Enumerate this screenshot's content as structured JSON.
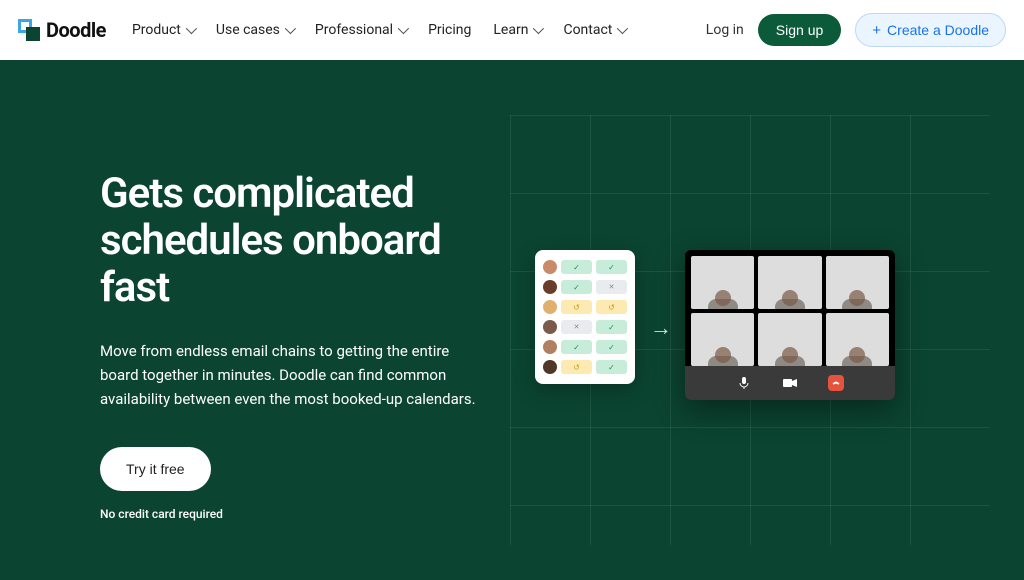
{
  "brand": {
    "name": "Doodle"
  },
  "nav": {
    "items": [
      {
        "label": "Product",
        "has_menu": true
      },
      {
        "label": "Use cases",
        "has_menu": true
      },
      {
        "label": "Professional",
        "has_menu": true
      },
      {
        "label": "Pricing",
        "has_menu": false
      },
      {
        "label": "Learn",
        "has_menu": true
      },
      {
        "label": "Contact",
        "has_menu": true
      }
    ]
  },
  "header_actions": {
    "login": "Log in",
    "signup": "Sign up",
    "create": "Create a Doodle"
  },
  "hero": {
    "title": "Gets complicated schedules onboard fast",
    "subtitle": "Move from endless email chains to getting the entire board together in minutes. Doodle can find common availability between even the most booked-up calendars.",
    "cta": "Try it free",
    "note": "No credit card required"
  },
  "illustration": {
    "poll_rows": [
      {
        "avatar": "#c98a6a",
        "cells": [
          "g-chk",
          "g-chk"
        ]
      },
      {
        "avatar": "#6a3c2a",
        "cells": [
          "g-chk",
          "n-x"
        ]
      },
      {
        "avatar": "#e0b070",
        "cells": [
          "y-sl",
          "y-sl"
        ]
      },
      {
        "avatar": "#7a5a4a",
        "cells": [
          "n-x",
          "g-chk"
        ]
      },
      {
        "avatar": "#b08060",
        "cells": [
          "g-chk",
          "g-chk"
        ]
      },
      {
        "avatar": "#503828",
        "cells": [
          "y-sl",
          "g-chk"
        ]
      }
    ],
    "arrow_glyph": "→",
    "video_tiles": 6,
    "controls": [
      "mic",
      "cam",
      "hangup"
    ]
  },
  "colors": {
    "hero_bg": "#0b4431",
    "signup_bg": "#0b5b3b",
    "create_fg": "#1a73e8"
  }
}
